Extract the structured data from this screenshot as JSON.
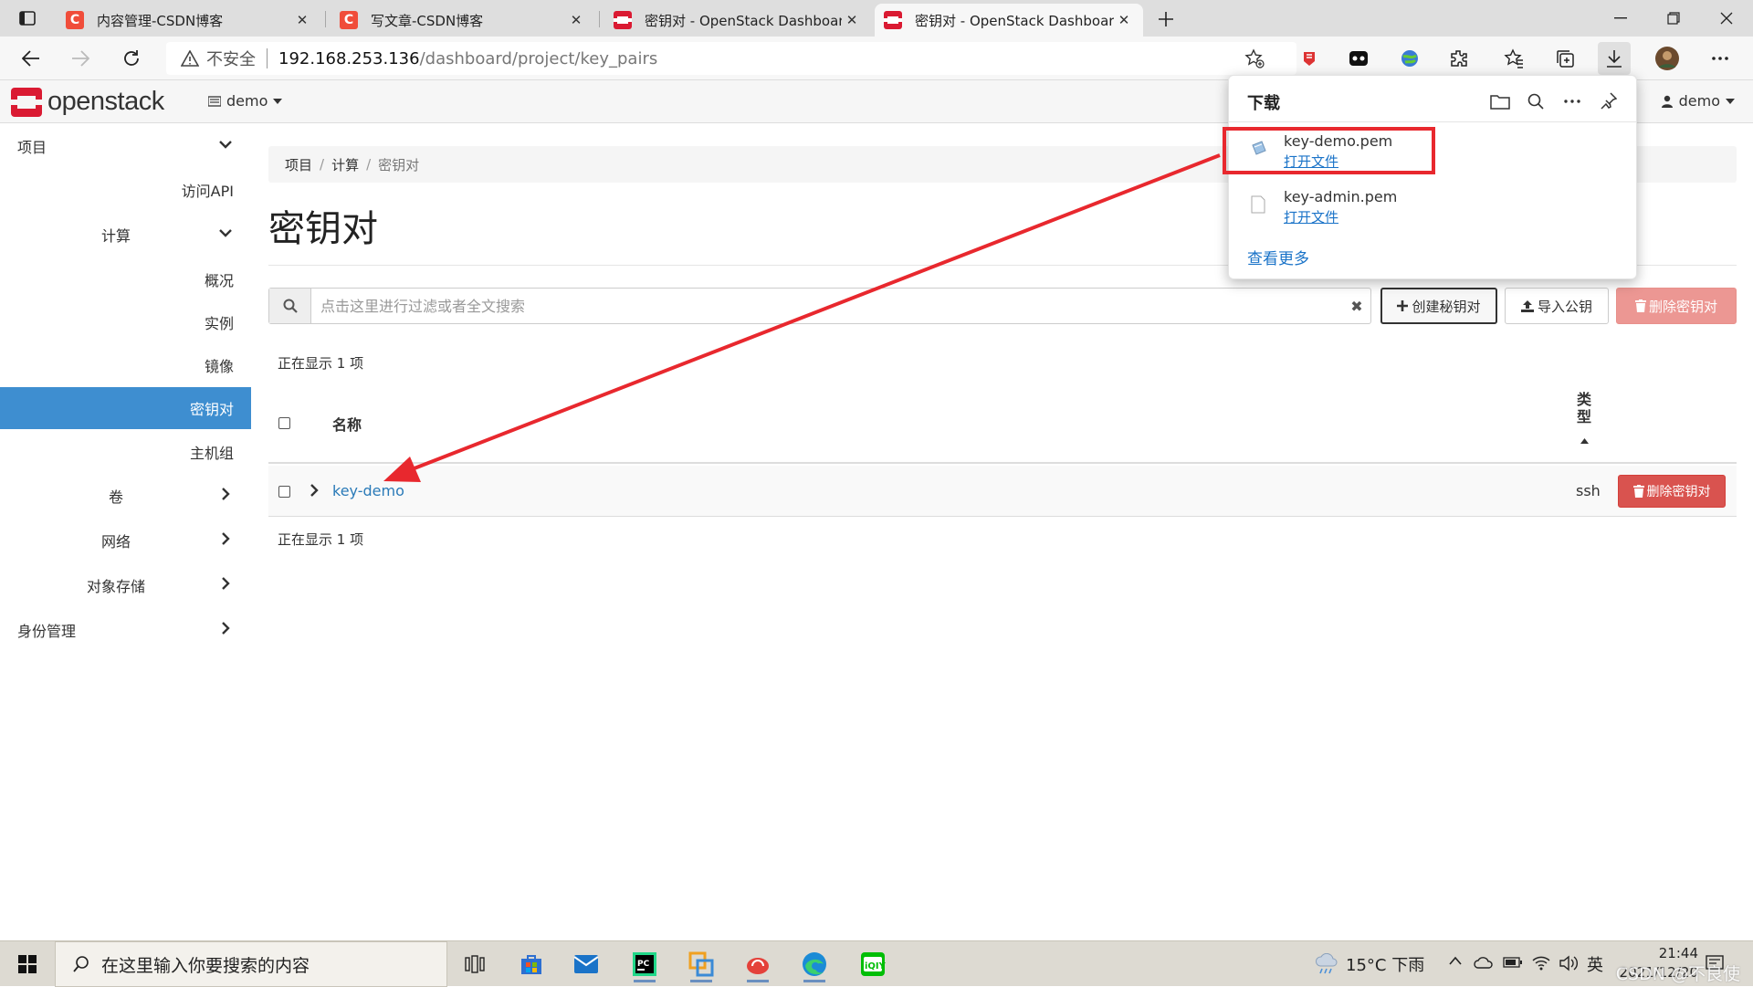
{
  "browser": {
    "tabs": [
      {
        "title": "内容管理-CSDN博客",
        "favicon": "csdn-icon"
      },
      {
        "title": "写文章-CSDN博客",
        "favicon": "csdn-icon"
      },
      {
        "title": "密钥对 - OpenStack Dashboard",
        "favicon": "openstack-icon"
      },
      {
        "title": "密钥对 - OpenStack Dashboard",
        "favicon": "openstack-icon",
        "active": true
      }
    ],
    "security_label": "不安全",
    "url_host": "192.168.253.136",
    "url_path": "/dashboard/project/key_pairs"
  },
  "header": {
    "logo_text": "openstack",
    "project": "demo",
    "user": "demo"
  },
  "sidebar": {
    "items": [
      {
        "label": "项目"
      },
      {
        "label": "访问API"
      },
      {
        "label": "计算"
      },
      {
        "label": "概况"
      },
      {
        "label": "实例"
      },
      {
        "label": "镜像"
      },
      {
        "label": "密钥对",
        "active": true
      },
      {
        "label": "主机组"
      },
      {
        "label": "卷"
      },
      {
        "label": "网络"
      },
      {
        "label": "对象存储"
      },
      {
        "label": "身份管理"
      }
    ]
  },
  "main": {
    "breadcrumb": [
      "项目",
      "计算",
      "密钥对"
    ],
    "title": "密钥对",
    "filter_placeholder": "点击这里进行过滤或者全文搜索",
    "buttons": {
      "create": "创建秘钥对",
      "import": "导入公钥",
      "delete": "删除密钥对"
    },
    "count_text": "正在显示 1 项",
    "table": {
      "columns": [
        "名称",
        "类型"
      ],
      "rows": [
        {
          "name": "key-demo",
          "type": "ssh",
          "action": "删除密钥对"
        }
      ]
    }
  },
  "downloads": {
    "title": "下载",
    "items": [
      {
        "name": "key-demo.pem",
        "action": "打开文件"
      },
      {
        "name": "key-admin.pem",
        "action": "打开文件"
      }
    ],
    "more": "查看更多"
  },
  "taskbar": {
    "search_placeholder": "在这里输入你要搜索的内容",
    "weather": "15°C 下雨",
    "ime": "英",
    "time": "21:44",
    "date": "2021/12/20",
    "watermark": "CSDN @不良使"
  },
  "colors": {
    "accent": "#3e8ed0",
    "danger": "#d9534f",
    "highlight": "#e8282e"
  }
}
